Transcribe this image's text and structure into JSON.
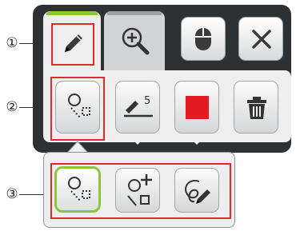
{
  "callouts": {
    "one": "①",
    "two": "②",
    "three": "③"
  },
  "toolbar": {
    "active_tab_color": "#8cc63f",
    "tab_pen": "pen-icon",
    "tab_zoom": "zoom-in-icon",
    "mouse_button": "mouse-icon",
    "close_button": "close-icon"
  },
  "tools": {
    "select_icon": "lasso-select-icon",
    "line_width_value": "5",
    "color_value": "#e31b23",
    "delete_icon": "trash-icon"
  },
  "select_modes": {
    "active_border": "#8cc63f",
    "items": [
      "lasso-select-icon",
      "add-select-icon",
      "freehand-lasso-icon"
    ]
  }
}
